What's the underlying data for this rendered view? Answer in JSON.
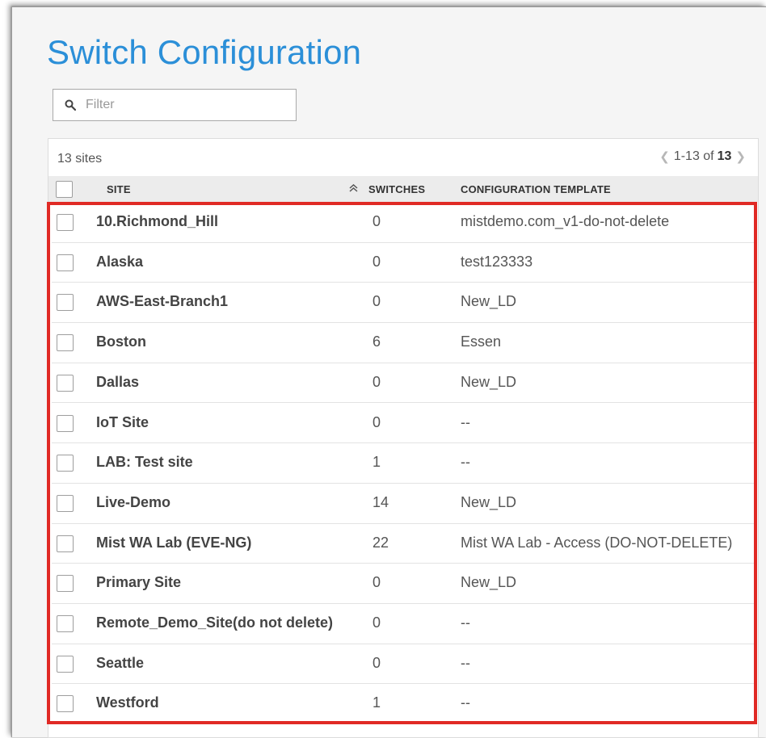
{
  "header": {
    "title": "Switch Configuration"
  },
  "filter": {
    "placeholder": "Filter",
    "value": ""
  },
  "summary": {
    "count_text": "13 sites"
  },
  "pagination": {
    "range_text": "1-13 of",
    "total": "13",
    "prev_icon": "chevron-left-icon",
    "next_icon": "chevron-right-icon"
  },
  "table": {
    "columns": {
      "site": "SITE",
      "switches": "SWITCHES",
      "template": "CONFIGURATION TEMPLATE"
    },
    "sort_icon": "double-chevron-up-icon",
    "rows": [
      {
        "site": "10.Richmond_Hill",
        "switches": "0",
        "template": "mistdemo.com_v1-do-not-delete"
      },
      {
        "site": "Alaska",
        "switches": "0",
        "template": "test123333"
      },
      {
        "site": "AWS-East-Branch1",
        "switches": "0",
        "template": "New_LD"
      },
      {
        "site": "Boston",
        "switches": "6",
        "template": "Essen"
      },
      {
        "site": "Dallas",
        "switches": "0",
        "template": "New_LD"
      },
      {
        "site": "IoT Site",
        "switches": "0",
        "template": "--"
      },
      {
        "site": "LAB: Test site",
        "switches": "1",
        "template": "--"
      },
      {
        "site": "Live-Demo",
        "switches": "14",
        "template": "New_LD"
      },
      {
        "site": "Mist WA Lab (EVE-NG)",
        "switches": "22",
        "template": "Mist WA Lab - Access (DO-NOT-DELETE)"
      },
      {
        "site": "Primary Site",
        "switches": "0",
        "template": "New_LD"
      },
      {
        "site": "Remote_Demo_Site(do not delete)",
        "switches": "0",
        "template": "--"
      },
      {
        "site": "Seattle",
        "switches": "0",
        "template": "--"
      },
      {
        "site": "Westford",
        "switches": "1",
        "template": "--"
      }
    ]
  },
  "colors": {
    "title": "#2b8fd8",
    "highlight": "#e02a25",
    "header_bg": "#ececec"
  }
}
